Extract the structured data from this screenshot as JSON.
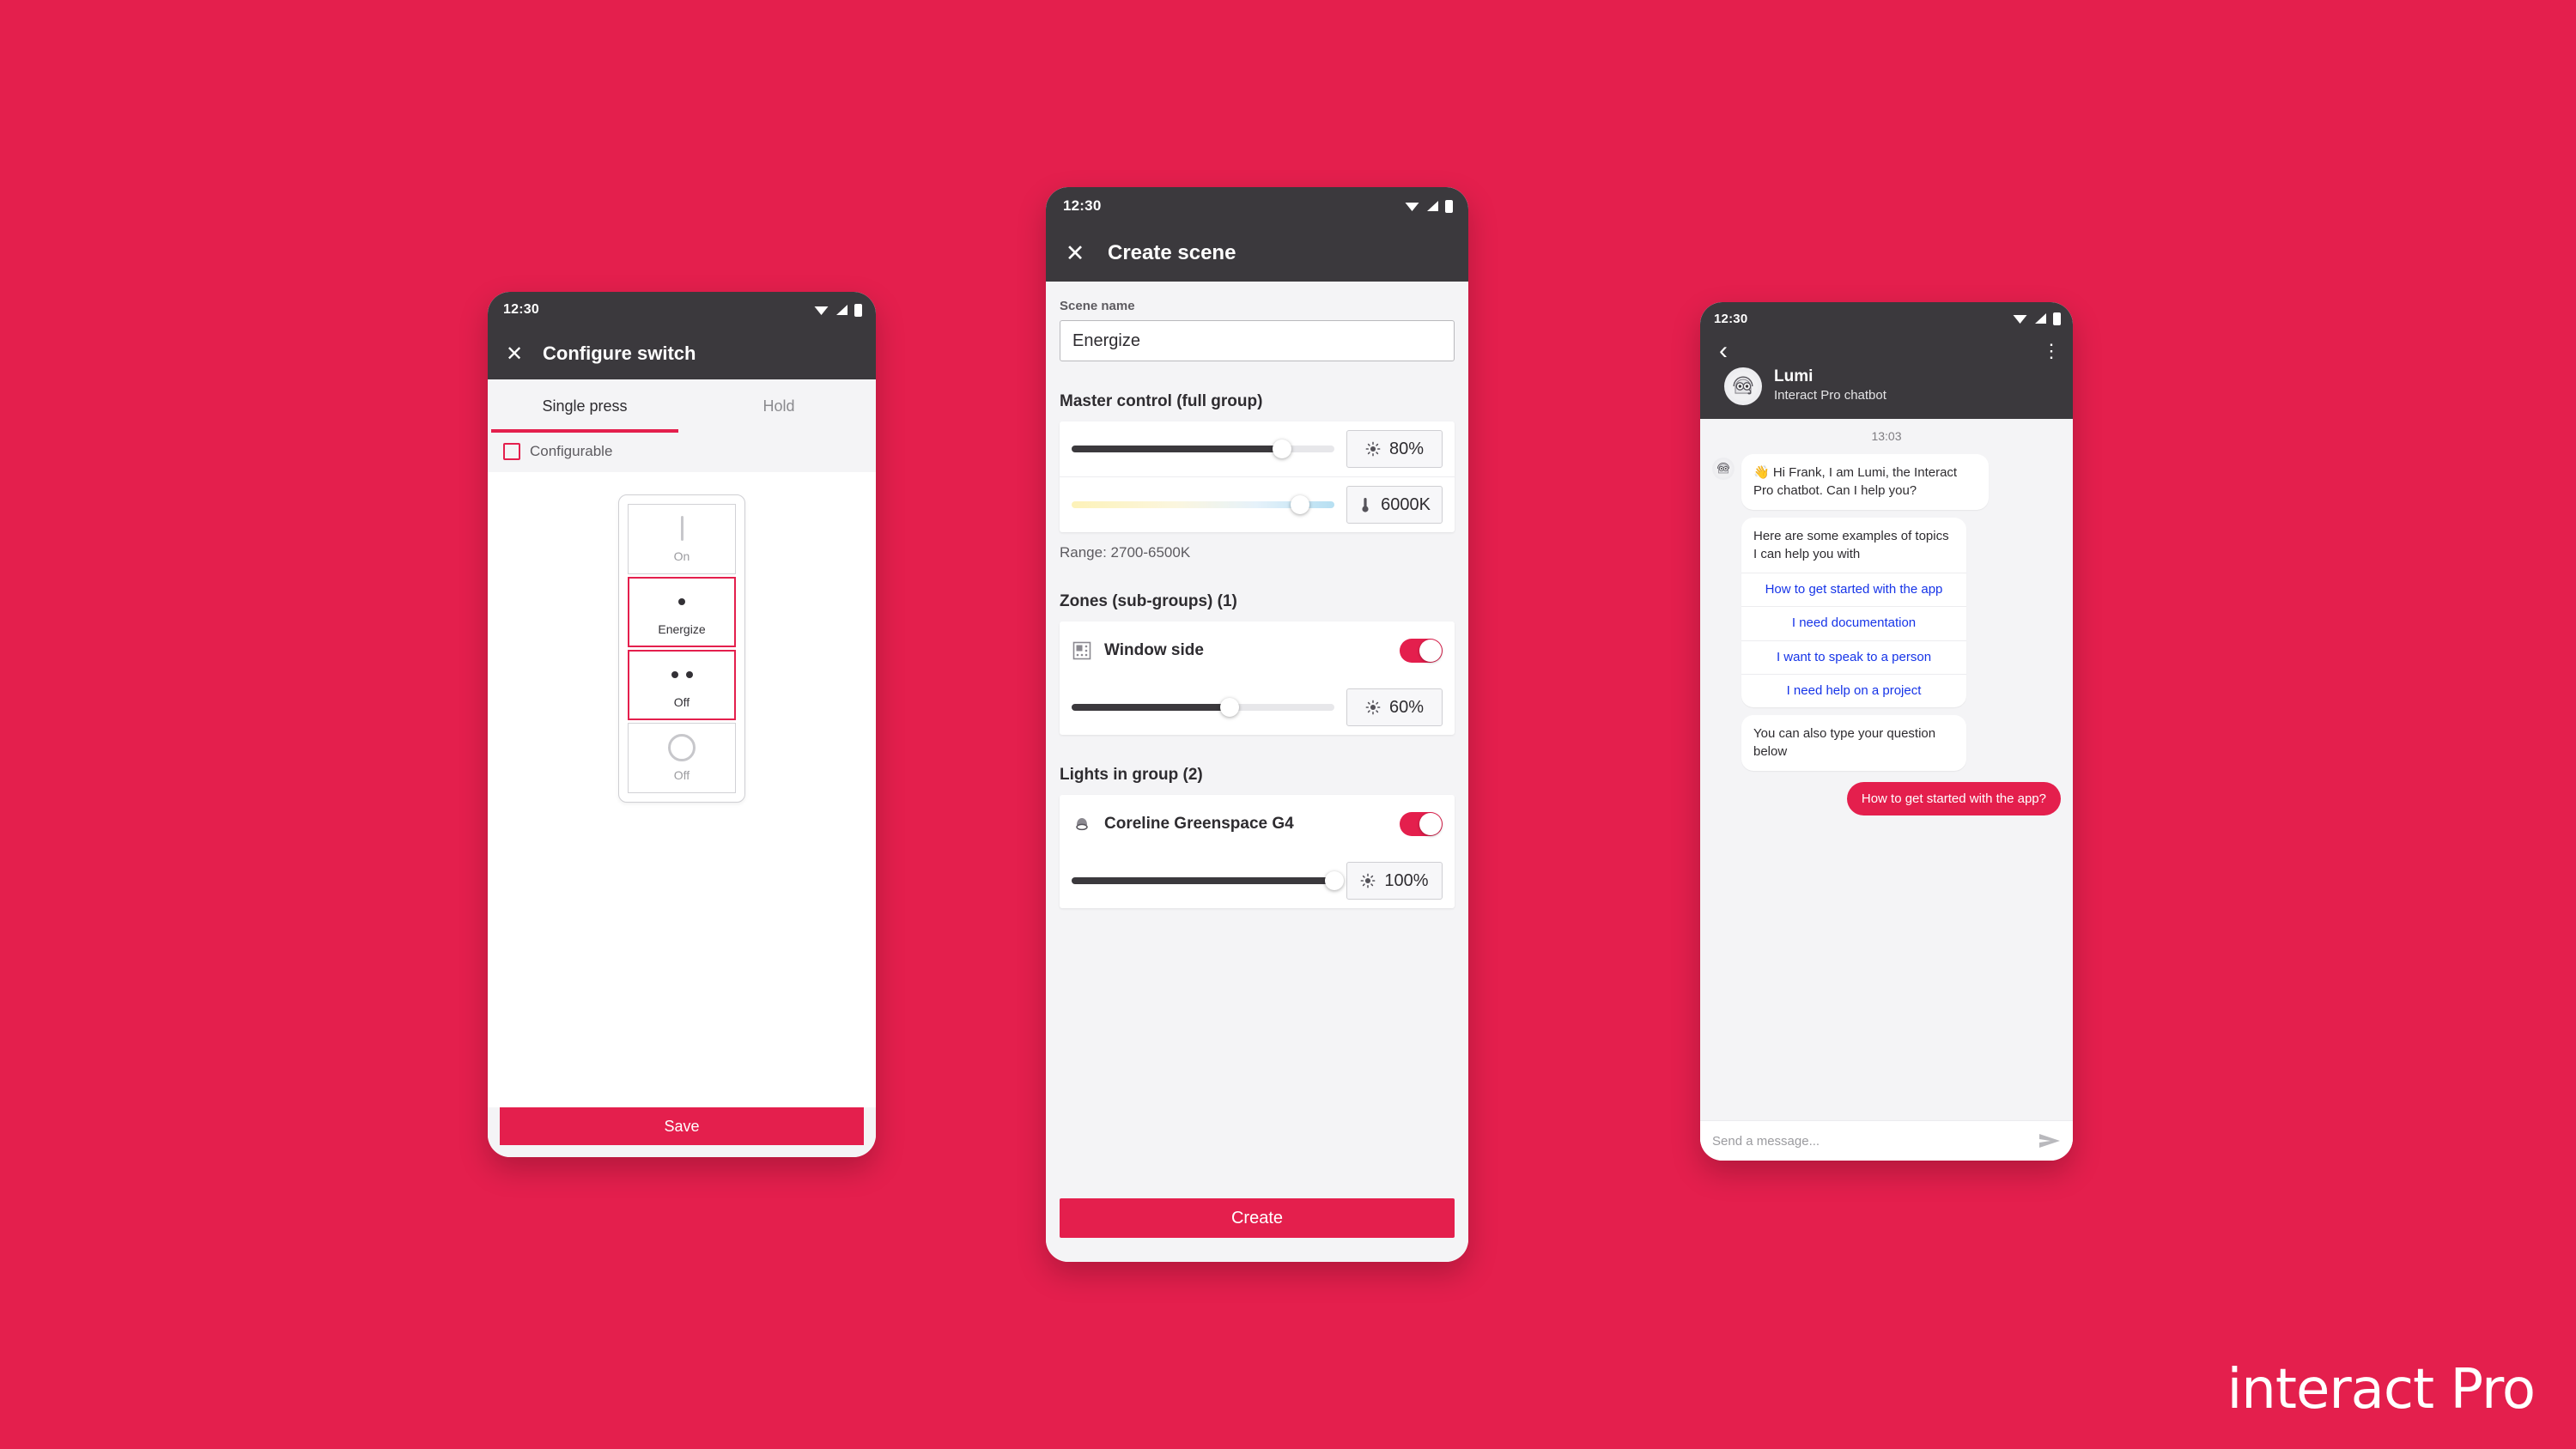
{
  "background_color": "#e41f4d",
  "brand": {
    "wordmark": "interact Pro"
  },
  "phone_configure_switch": {
    "status_bar": {
      "time": "12:30",
      "icons": [
        "wifi-icon",
        "signal-icon",
        "battery-icon"
      ]
    },
    "appbar": {
      "close_label": "✕",
      "title": "Configure switch"
    },
    "tabs": [
      {
        "label": "Single press",
        "active": true
      },
      {
        "label": "Hold",
        "active": false
      }
    ],
    "configurable": {
      "label": "Configurable",
      "checked": false
    },
    "switch_keys": [
      {
        "glyph": "bar",
        "caption": "On",
        "selected": false
      },
      {
        "glyph": "one-dot",
        "caption": "Energize",
        "selected": true
      },
      {
        "glyph": "two-dots",
        "caption": "Off",
        "selected": true
      },
      {
        "glyph": "circle",
        "caption": "Off",
        "selected": false
      }
    ],
    "save_label": "Save"
  },
  "phone_create_scene": {
    "status_bar": {
      "time": "12:30"
    },
    "appbar": {
      "close_label": "✕",
      "title": "Create scene"
    },
    "scene_name": {
      "label": "Scene name",
      "value": "Energize",
      "placeholder": "Scene name"
    },
    "master_control": {
      "title": "Master control (full group)",
      "brightness": {
        "icon": "brightness-icon",
        "value": "80%",
        "percent": 80
      },
      "color_temp": {
        "icon": "temperature-icon",
        "value": "6000K",
        "percent": 87
      },
      "range_note": "Range: 2700-6500K"
    },
    "zones": {
      "title": "Zones (sub-groups) (1)",
      "items": [
        {
          "icon": "zone-icon",
          "name": "Window side",
          "enabled": true,
          "brightness": {
            "icon": "brightness-icon",
            "value": "60%",
            "percent": 60
          }
        }
      ]
    },
    "lights": {
      "title": "Lights in group (2)",
      "items": [
        {
          "icon": "downlight-icon",
          "name": "Coreline Greenspace G4",
          "enabled": true
        },
        {
          "icon": "downlight-icon",
          "name": "",
          "brightness": {
            "value": "100%",
            "percent": 100
          }
        }
      ]
    },
    "create_label": "Create"
  },
  "phone_chatbot": {
    "status_bar": {
      "time": "12:30"
    },
    "appbar": {
      "back_label": "‹",
      "overflow_label": "⋮",
      "bot_name": "Lumi",
      "bot_subtitle": "Interact Pro chatbot"
    },
    "conversation": {
      "timestamp": "13:03",
      "greeting": "👋 Hi Frank, I am Lumi, the Interact Pro chatbot. Can I help you?",
      "topics_intro": "Here are some examples of topics I can help you with",
      "topic_options": [
        "How to get started with the app",
        "I need documentation",
        "I want to speak to a person",
        "I need help on a project"
      ],
      "type_hint": "You can also type your question below",
      "user_message": "How to get started with the app?"
    },
    "composer": {
      "placeholder": "Send a message...",
      "send_icon": "send-icon"
    }
  }
}
